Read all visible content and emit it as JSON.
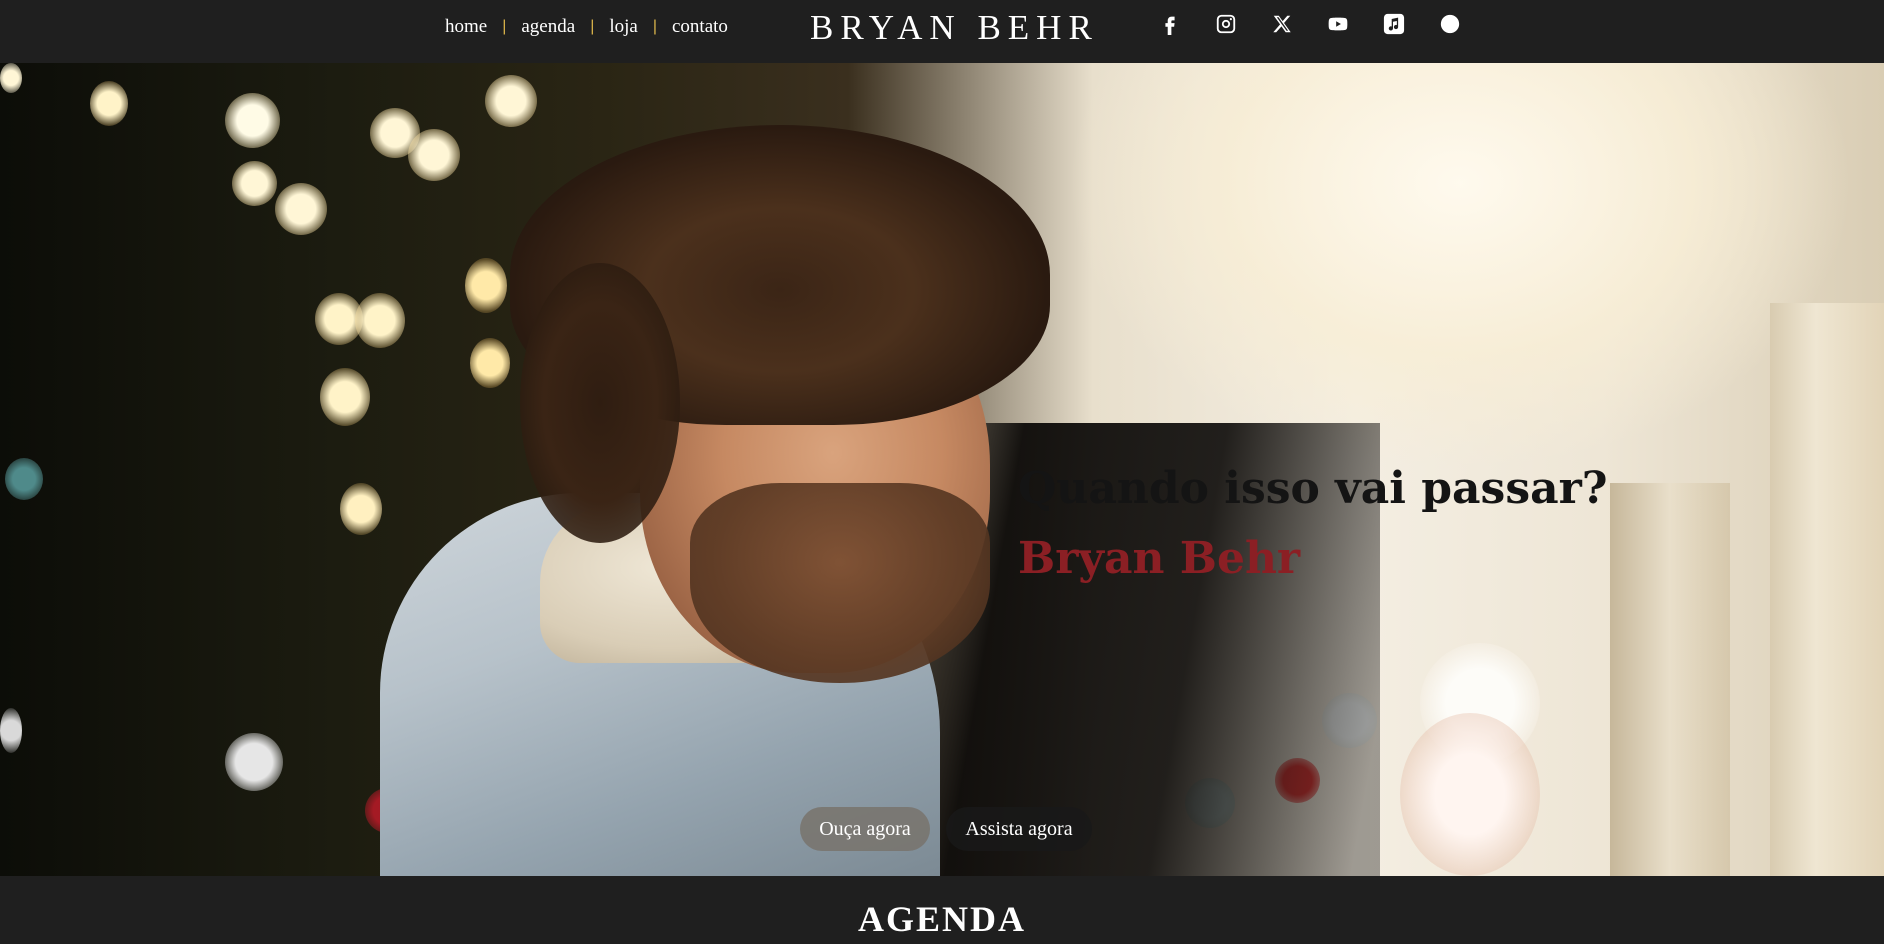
{
  "nav": {
    "items": [
      {
        "label": "home"
      },
      {
        "label": "agenda"
      },
      {
        "label": "loja"
      },
      {
        "label": "contato"
      }
    ],
    "separator": "|"
  },
  "logo": {
    "text": "BRYAN BEHR"
  },
  "socials": [
    {
      "icon": "facebook-icon"
    },
    {
      "icon": "instagram-icon"
    },
    {
      "icon": "x-icon"
    },
    {
      "icon": "youtube-icon"
    },
    {
      "icon": "apple-music-icon"
    },
    {
      "icon": "spotify-icon"
    }
  ],
  "hero": {
    "headline": "Quando isso vai passar?",
    "artist": "Bryan Behr",
    "buttons": {
      "listen": "Ouça agora",
      "watch": "Assista agora"
    }
  },
  "section": {
    "title": "AGENDA"
  },
  "colors": {
    "background": "#1f1f1f",
    "nav_separator": "#d8b24a",
    "artist_name": "#8b1f24",
    "headline": "#141414"
  }
}
